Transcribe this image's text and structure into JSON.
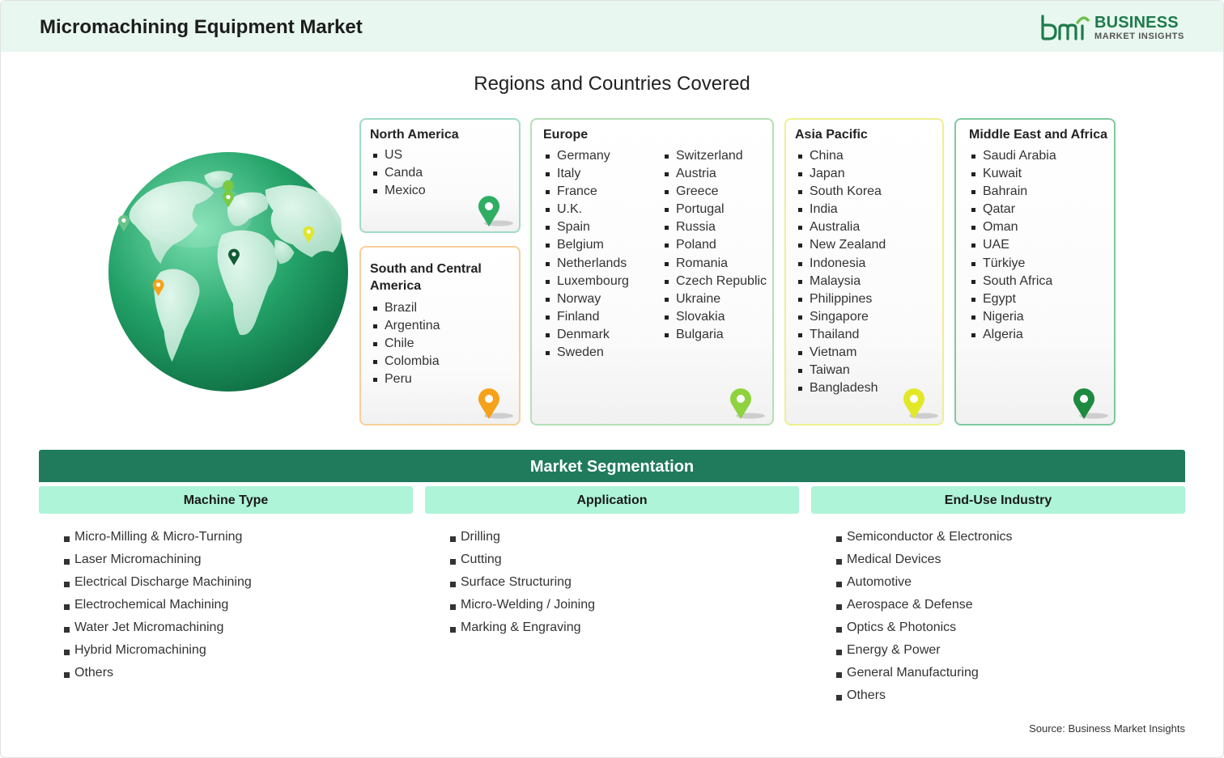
{
  "header": {
    "title": "Micromachining Equipment Market",
    "logo": {
      "brand_line1": "BUSINESS",
      "brand_line2": "MARKET INSIGHTS",
      "mark_text": "bmi"
    }
  },
  "regions_title": "Regions and Countries Covered",
  "regions": {
    "north_america": {
      "title": "North America",
      "countries": [
        "US",
        "Canda",
        "Mexico"
      ],
      "pin_color": "#2fae63"
    },
    "south_central_america": {
      "title": "South and Central America",
      "countries": [
        "Brazil",
        "Argentina",
        "Chile",
        "Colombia",
        "Peru"
      ],
      "pin_color": "#f5a21b"
    },
    "europe": {
      "title": "Europe",
      "countries_col1": [
        "Germany",
        "Italy",
        "France",
        "U.K.",
        "Spain",
        "Belgium",
        "Netherlands",
        "Luxembourg",
        "Norway",
        "Finland",
        "Denmark",
        "Sweden"
      ],
      "countries_col2": [
        "Switzerland",
        "Austria",
        "Greece",
        "Portugal",
        "Russia",
        "Poland",
        "Romania",
        "Czech Republic",
        "Ukraine",
        "Slovakia",
        "Bulgaria"
      ],
      "pin_color": "#8fd23f"
    },
    "asia_pacific": {
      "title": "Asia Pacific",
      "countries": [
        "China",
        "Japan",
        "South Korea",
        "India",
        "Australia",
        "New Zealand",
        "Indonesia",
        "Malaysia",
        "Philippines",
        "Singapore",
        "Thailand",
        "Vietnam",
        "Taiwan",
        "Bangladesh"
      ],
      "pin_color": "#e2e825"
    },
    "middle_east_africa": {
      "title": "Middle East and Africa",
      "countries": [
        "Saudi Arabia",
        "Kuwait",
        "Bahrain",
        "Qatar",
        "Oman",
        "UAE",
        "Türkiye",
        "South Africa",
        "Egypt",
        "Nigeria",
        "Algeria"
      ],
      "pin_color": "#1c8a3f"
    }
  },
  "segmentation": {
    "title": "Market Segmentation",
    "machine_type": {
      "heading": "Machine Type",
      "items": [
        "Micro-Milling & Micro-Turning",
        "Laser Micromachining",
        "Electrical Discharge Machining",
        "Electrochemical Machining",
        "Water Jet Micromachining",
        "Hybrid Micromachining",
        "Others"
      ]
    },
    "application": {
      "heading": "Application",
      "items": [
        "Drilling",
        "Cutting",
        "Surface Structuring",
        "Micro-Welding / Joining",
        "Marking & Engraving"
      ]
    },
    "end_use": {
      "heading": "End-Use Industry",
      "items": [
        "Semiconductor & Electronics",
        "Medical Devices",
        "Automotive",
        "Aerospace & Defense",
        "Optics & Photonics",
        "Energy & Power",
        "General Manufacturing",
        "Others"
      ]
    }
  },
  "source": "Source: Business Market Insights"
}
